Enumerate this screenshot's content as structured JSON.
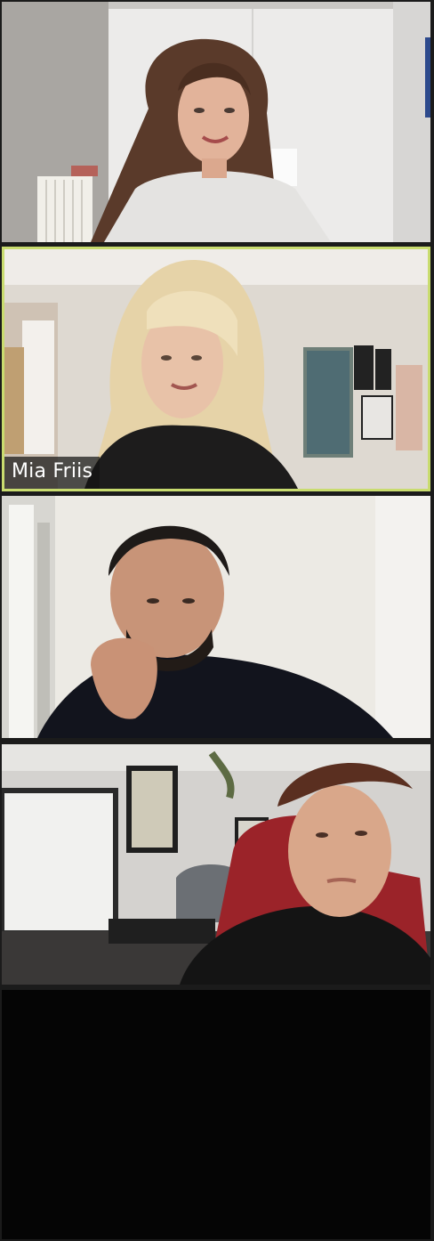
{
  "meeting": {
    "view": "gallery",
    "active_speaker_color": "#c9dc6f",
    "background_color": "#1b1b1b"
  },
  "participants": [
    {
      "name_tag": "",
      "video": "on",
      "active_speaker": false
    },
    {
      "name_tag": "Mia Friis",
      "video": "on",
      "active_speaker": true
    },
    {
      "name_tag": "",
      "video": "on",
      "active_speaker": false
    },
    {
      "name_tag": "",
      "video": "on",
      "active_speaker": false
    }
  ]
}
